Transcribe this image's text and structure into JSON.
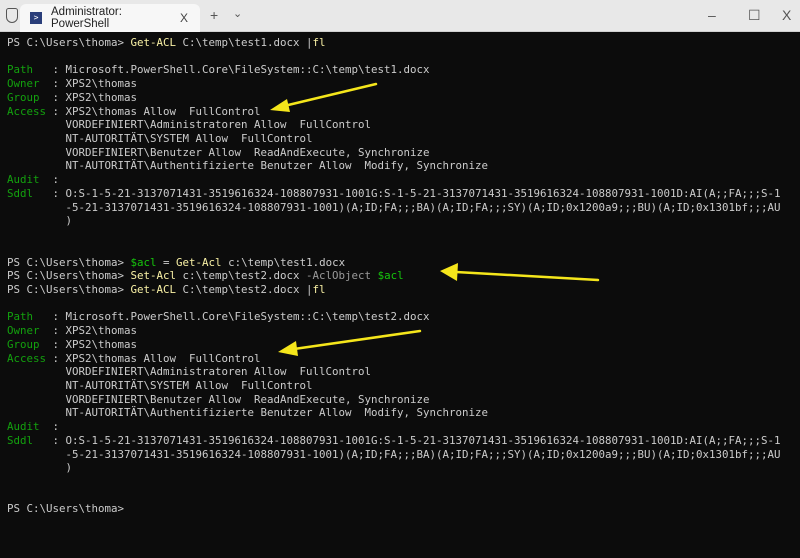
{
  "window": {
    "title": "Administrator: PowerShell",
    "tab_close": "X",
    "new_tab": "+",
    "dropdown": "⌄",
    "minimize": "–",
    "maximize": "☐",
    "close": "X"
  },
  "colors": {
    "background": "#0c0c0c",
    "text": "#cccccc",
    "command": "#f9f1a5",
    "key": "#13a10e",
    "variable": "#16c60c",
    "arrow": "#f5e61b"
  },
  "terminal": {
    "lines": [
      [
        {
          "t": "PS C:\\Users\\thoma> "
        },
        {
          "t": "Get-ACL",
          "c": "cmd"
        },
        {
          "t": " C:\\temp\\test1.docx |"
        },
        {
          "t": "fl",
          "c": "cmd"
        }
      ],
      [],
      [
        {
          "t": "Path",
          "c": "key"
        },
        {
          "t": "   : Microsoft.PowerShell.Core\\FileSystem::C:\\temp\\test1.docx"
        }
      ],
      [
        {
          "t": "Owner",
          "c": "key"
        },
        {
          "t": "  : XPS2\\thomas"
        }
      ],
      [
        {
          "t": "Group",
          "c": "key"
        },
        {
          "t": "  : XPS2\\thomas"
        }
      ],
      [
        {
          "t": "Access",
          "c": "key"
        },
        {
          "t": " : XPS2\\thomas Allow  FullControl"
        }
      ],
      [
        {
          "t": "         VORDEFINIERT\\Administratoren Allow  FullControl"
        }
      ],
      [
        {
          "t": "         NT-AUTORITÄT\\SYSTEM Allow  FullControl"
        }
      ],
      [
        {
          "t": "         VORDEFINIERT\\Benutzer Allow  ReadAndExecute, Synchronize"
        }
      ],
      [
        {
          "t": "         NT-AUTORITÄT\\Authentifizierte Benutzer Allow  Modify, Synchronize"
        }
      ],
      [
        {
          "t": "Audit",
          "c": "key"
        },
        {
          "t": "  :"
        }
      ],
      [
        {
          "t": "Sddl",
          "c": "key"
        },
        {
          "t": "   : O:S-1-5-21-3137071431-3519616324-108807931-1001G:S-1-5-21-3137071431-3519616324-108807931-1001D:AI(A;;FA;;;S-1"
        }
      ],
      [
        {
          "t": "         -5-21-3137071431-3519616324-108807931-1001)(A;ID;FA;;;BA)(A;ID;FA;;;SY)(A;ID;0x1200a9;;;BU)(A;ID;0x1301bf;;;AU"
        }
      ],
      [
        {
          "t": "         )"
        }
      ],
      [],
      [],
      [
        {
          "t": "PS C:\\Users\\thoma> "
        },
        {
          "t": "$acl",
          "c": "var"
        },
        {
          "t": " = "
        },
        {
          "t": "Get-Acl",
          "c": "cmd"
        },
        {
          "t": " c:\\temp\\test1.docx"
        }
      ],
      [
        {
          "t": "PS C:\\Users\\thoma> "
        },
        {
          "t": "Set-Acl",
          "c": "cmd"
        },
        {
          "t": " c:\\temp\\test2.docx "
        },
        {
          "t": "-AclObject",
          "c": "param"
        },
        {
          "t": " "
        },
        {
          "t": "$acl",
          "c": "var"
        }
      ],
      [
        {
          "t": "PS C:\\Users\\thoma> "
        },
        {
          "t": "Get-ACL",
          "c": "cmd"
        },
        {
          "t": " C:\\temp\\test2.docx |"
        },
        {
          "t": "fl",
          "c": "cmd"
        }
      ],
      [],
      [
        {
          "t": "Path",
          "c": "key"
        },
        {
          "t": "   : Microsoft.PowerShell.Core\\FileSystem::C:\\temp\\test2.docx"
        }
      ],
      [
        {
          "t": "Owner",
          "c": "key"
        },
        {
          "t": "  : XPS2\\thomas"
        }
      ],
      [
        {
          "t": "Group",
          "c": "key"
        },
        {
          "t": "  : XPS2\\thomas"
        }
      ],
      [
        {
          "t": "Access",
          "c": "key"
        },
        {
          "t": " : XPS2\\thomas Allow  FullControl"
        }
      ],
      [
        {
          "t": "         VORDEFINIERT\\Administratoren Allow  FullControl"
        }
      ],
      [
        {
          "t": "         NT-AUTORITÄT\\SYSTEM Allow  FullControl"
        }
      ],
      [
        {
          "t": "         VORDEFINIERT\\Benutzer Allow  ReadAndExecute, Synchronize"
        }
      ],
      [
        {
          "t": "         NT-AUTORITÄT\\Authentifizierte Benutzer Allow  Modify, Synchronize"
        }
      ],
      [
        {
          "t": "Audit",
          "c": "key"
        },
        {
          "t": "  :"
        }
      ],
      [
        {
          "t": "Sddl",
          "c": "key"
        },
        {
          "t": "   : O:S-1-5-21-3137071431-3519616324-108807931-1001G:S-1-5-21-3137071431-3519616324-108807931-1001D:AI(A;;FA;;;S-1"
        }
      ],
      [
        {
          "t": "         -5-21-3137071431-3519616324-108807931-1001)(A;ID;FA;;;BA)(A;ID;FA;;;SY)(A;ID;0x1200a9;;;BU)(A;ID;0x1301bf;;;AU"
        }
      ],
      [
        {
          "t": "         )"
        }
      ],
      [],
      [],
      [
        {
          "t": "PS C:\\Users\\thoma> "
        }
      ]
    ]
  }
}
